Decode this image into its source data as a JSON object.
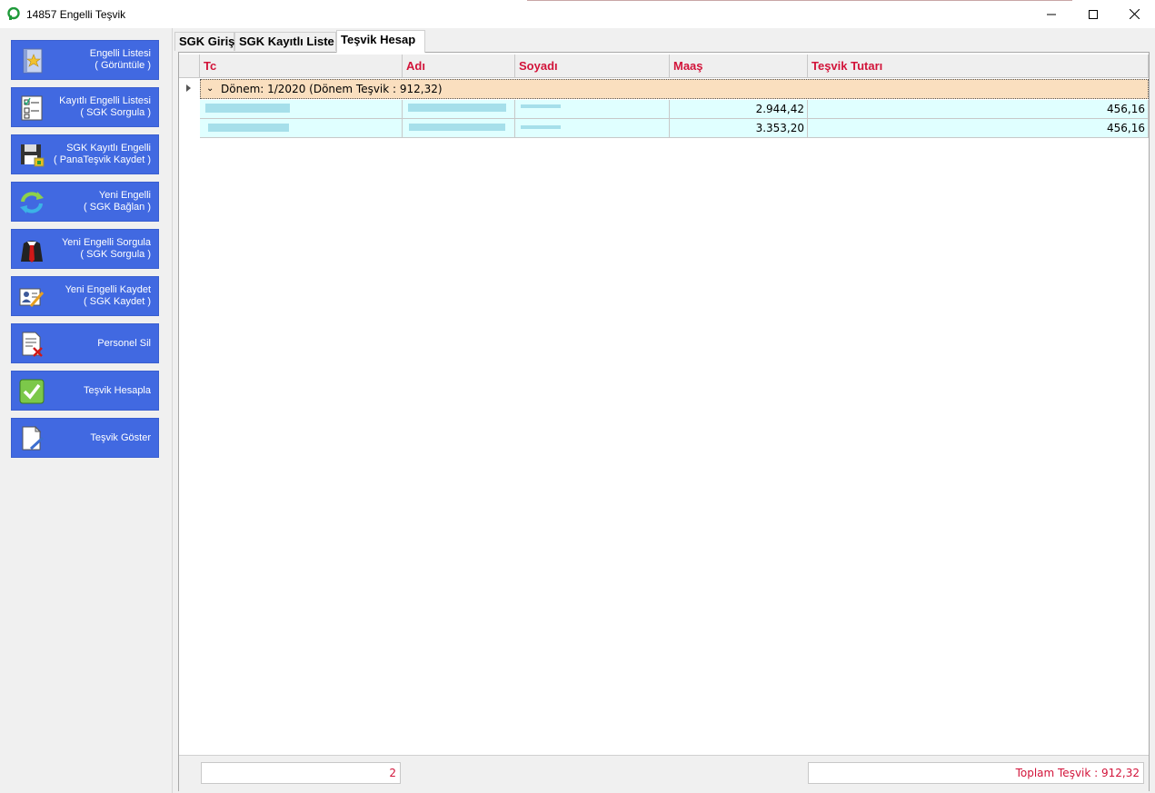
{
  "window": {
    "title": "14857 Engelli Teşvik",
    "icon": "app-logo-icon"
  },
  "sidebar": {
    "items": [
      {
        "line1": "Engelli Listesi",
        "line2": "( Görüntüle )",
        "icon": "star-book-icon"
      },
      {
        "line1": "Kayıtlı Engelli Listesi",
        "line2": "( SGK Sorgula )",
        "icon": "checklist-icon"
      },
      {
        "line1": "SGK Kayıtlı Engelli",
        "line2": "( PanaTeşvik Kaydet )",
        "icon": "save-disk-icon"
      },
      {
        "line1": "Yeni Engelli",
        "line2": "( SGK Bağlan )",
        "icon": "refresh-arrows-icon"
      },
      {
        "line1": "Yeni Engelli Sorgula",
        "line2": "( SGK Sorgula )",
        "icon": "person-tie-icon"
      },
      {
        "line1": "Yeni Engelli Kaydet",
        "line2": "( SGK Kaydet )",
        "icon": "id-card-pen-icon"
      },
      {
        "line1": "Personel Sil",
        "line2": "",
        "icon": "document-delete-icon"
      },
      {
        "line1": "Teşvik Hesapla",
        "line2": "",
        "icon": "checkmark-icon"
      },
      {
        "line1": "Teşvik Göster",
        "line2": "",
        "icon": "document-pen-icon"
      }
    ]
  },
  "tabs": [
    {
      "label": "SGK Giriş",
      "active": false
    },
    {
      "label": "SGK Kayıtlı Liste",
      "active": false
    },
    {
      "label": "Teşvik Hesap",
      "active": true
    }
  ],
  "grid": {
    "columns": [
      "Tc",
      "Adı",
      "Soyadı",
      "Maaş",
      "Teşvik Tutarı"
    ],
    "group": {
      "label": "Dönem: 1/2020 (Dönem Teşvik : 912,32)"
    },
    "rows": [
      {
        "maas": "2.944,42",
        "tesvik": "456,16"
      },
      {
        "maas": "3.353,20",
        "tesvik": "456,16"
      }
    ],
    "footer": {
      "count": "2",
      "total": "Toplam Teşvik : 912,32"
    }
  },
  "colors": {
    "sidebar_button": "#4169e1",
    "header_text": "#d2143a",
    "group_row": "#fadfbf",
    "data_row": "#e0ffff",
    "redaction": "#a6dfea"
  }
}
